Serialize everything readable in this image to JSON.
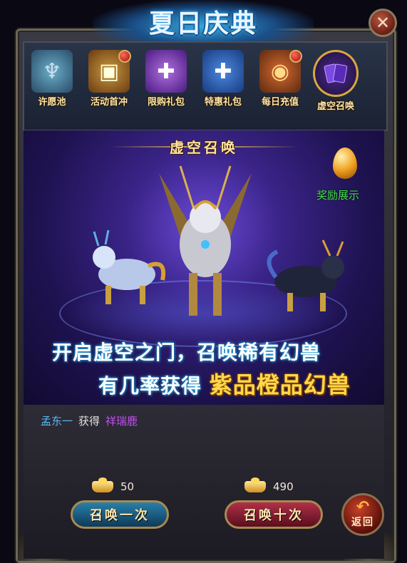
{
  "header": {
    "title": "夏日庆典",
    "close_icon": "close-icon"
  },
  "tabs": [
    {
      "label": "许愿池",
      "icon": "wish-statue-icon",
      "badge": false,
      "active": false
    },
    {
      "label": "活动首冲",
      "icon": "treasure-chest-icon",
      "badge": true,
      "active": false
    },
    {
      "label": "限购礼包",
      "icon": "purple-gift-icon",
      "badge": false,
      "active": false
    },
    {
      "label": "特惠礼包",
      "icon": "blue-gift-icon",
      "badge": false,
      "active": false
    },
    {
      "label": "每日充值",
      "icon": "treasure-pot-icon",
      "badge": true,
      "active": false
    },
    {
      "label": "虚空召唤",
      "icon": "void-cards-icon",
      "badge": false,
      "active": true
    }
  ],
  "main": {
    "section_title": "虚空召唤",
    "reward_label": "奖励展示",
    "promo_line1": "开启虚空之门，召唤稀有幻兽",
    "promo_line2_prefix": "有几率获得",
    "promo_line2_highlight": "紫品橙品幻兽"
  },
  "feed": {
    "player": "孟东一",
    "verb": "获得",
    "item": "祥瑞鹿"
  },
  "summon": {
    "single_cost": "50",
    "single_label": "召唤一次",
    "ten_cost": "490",
    "ten_label": "召唤十次",
    "currency_icon": "gold-ingot-icon"
  },
  "back_label": "返回",
  "colors": {
    "player": "#5ab8f0",
    "item": "#c050f0",
    "reward_label": "#40e040",
    "highlight": "#ffd84a"
  }
}
